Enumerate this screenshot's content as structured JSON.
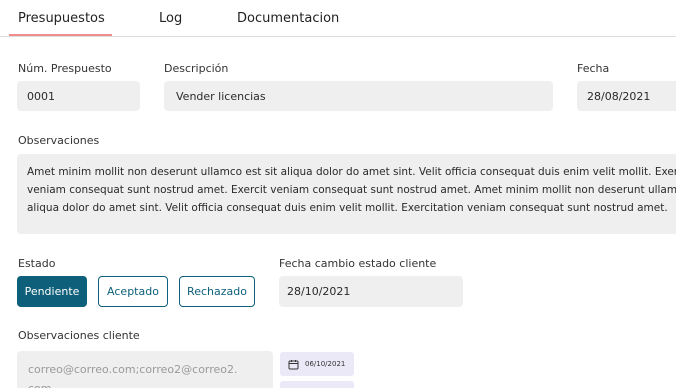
{
  "tabs": [
    {
      "label": "Presupuestos",
      "active": true
    },
    {
      "label": "Log",
      "active": false
    },
    {
      "label": "Documentacion",
      "active": false
    }
  ],
  "colors": {
    "accent": "#0e5f7a",
    "tab_underline": "#f08c8c",
    "field_bg": "#efefef",
    "chip_bg": "#ebe9f7"
  },
  "form": {
    "num_presupuesto": {
      "label": "Núm. Prespuesto",
      "value": "0001"
    },
    "descripcion": {
      "label": "Descripción",
      "value": "Vender licencias"
    },
    "fecha": {
      "label": "Fecha",
      "value": "28/08/2021"
    },
    "observaciones": {
      "label": "Observaciones",
      "lines": [
        "Amet minim mollit non deserunt ullamco est sit aliqua dolor do amet sint. Velit officia consequat duis enim velit mollit. Exercitation",
        "veniam consequat sunt nostrud amet. Exercit veniam consequat sunt nostrud amet. Amet minim mollit non deserunt ullamco est sit",
        "aliqua dolor do amet sint. Velit officia consequat duis enim velit mollit. Exercitation veniam consequat sunt nostrud amet."
      ]
    },
    "estado": {
      "label": "Estado",
      "options": [
        {
          "label": "Pendiente",
          "selected": true
        },
        {
          "label": "Aceptado",
          "selected": false
        },
        {
          "label": "Rechazado",
          "selected": false
        }
      ]
    },
    "fecha_cambio": {
      "label": "Fecha cambio estado cliente",
      "value": "28/10/2021"
    },
    "observaciones_cliente": {
      "label": "Observaciones cliente",
      "lines": [
        "correo@correo.com;correo2@correo2.",
        "com"
      ]
    },
    "date_chips": [
      {
        "icon": "calendar-icon",
        "date": "06/10/2021"
      },
      {
        "icon": "calendar-icon",
        "date": ""
      }
    ]
  }
}
